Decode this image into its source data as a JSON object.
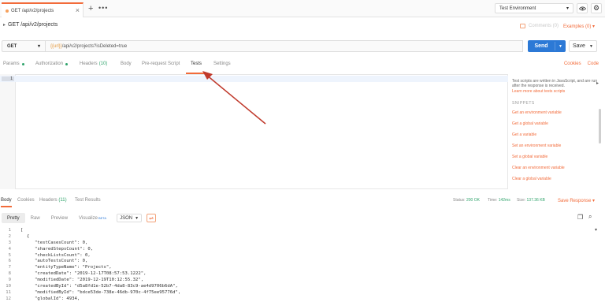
{
  "tabbar": {
    "tab_title": "GET /api/v2/projects",
    "close_glyph": "×",
    "plus_glyph": "+",
    "more_glyph": "•••",
    "environment": "Test Environment",
    "eye_icon": "eye-icon",
    "gear_icon": "gear-icon"
  },
  "header": {
    "title": "GET /api/v2/projects",
    "comments": "Comments (0)",
    "examples": "Examples (0) ▾"
  },
  "request": {
    "method": "GET",
    "url_var": "{{url}}",
    "url_rest": "/api/v2/projects?isDeleted=true",
    "send": "Send",
    "save": "Save"
  },
  "tabs": [
    {
      "label": "Params",
      "dot": true
    },
    {
      "label": "Authorization",
      "dot": true
    },
    {
      "label": "Headers",
      "count": "(10)"
    },
    {
      "label": "Body"
    },
    {
      "label": "Pre-request Script"
    },
    {
      "label": "Tests",
      "active": true
    },
    {
      "label": "Settings"
    }
  ],
  "right_links": {
    "cookies": "Cookies",
    "code": "Code"
  },
  "editor": {
    "line_number": "1"
  },
  "snippets": {
    "description": "Test scripts are written in JavaScript, and are run after the response is received.",
    "learn_more": "Learn more about tests scripts",
    "heading": "SNIPPETS",
    "items": [
      "Get an environment variable",
      "Get a global variable",
      "Get a variable",
      "Set an environment variable",
      "Set a global variable",
      "Clear an environment variable",
      "Clear a global variable"
    ]
  },
  "response_tabs": {
    "body": "Body",
    "cookies": "Cookies",
    "headers": "Headers",
    "headers_count": "(11)",
    "test_results": "Test Results"
  },
  "response_status": {
    "status_label": "Status:",
    "status": "200 OK",
    "time_label": "Time:",
    "time": "142ms",
    "size_label": "Size:",
    "size": "137.36 KB",
    "save_response": "Save Response ▾"
  },
  "format_toolbar": {
    "pretty": "Pretty",
    "raw": "Raw",
    "preview": "Preview",
    "visualize": "Visualize",
    "beta": "BETA",
    "format": "JSON",
    "wrap_icon": "wrap-lines-icon",
    "copy_icon": "copy-icon",
    "search_icon": "search-icon"
  },
  "response_body": [
    {
      "n": "1",
      "text": "[",
      "indent": 0
    },
    {
      "n": "2",
      "text": "{",
      "indent": 1
    },
    {
      "n": "3",
      "text": "\"testCasesCount\": 0,",
      "indent": 2
    },
    {
      "n": "4",
      "text": "\"sharedStepsCount\": 0,",
      "indent": 2
    },
    {
      "n": "5",
      "text": "\"checkListsCount\": 0,",
      "indent": 2
    },
    {
      "n": "6",
      "text": "\"autoTestsCount\": 0,",
      "indent": 2
    },
    {
      "n": "7",
      "text": "\"entityTypeName\": \"Projects\",",
      "indent": 2
    },
    {
      "n": "8",
      "text": "\"createdDate\": \"2019-12-17T08:57:53.1222\",",
      "indent": 2
    },
    {
      "n": "9",
      "text": "\"modifiedDate\": \"2019-12-19T10:12:55.32\",",
      "indent": 2
    },
    {
      "n": "10",
      "text": "\"createdById\": \"d5a8fd1e-52b7-4da8-83c9-ae4d9706b6dA\",",
      "indent": 2
    },
    {
      "n": "11",
      "text": "\"modifiedById\": \"bdce53de-738e-46db-970c-4f75ee95776d\",",
      "indent": 2
    },
    {
      "n": "12",
      "text": "\"globalId\": 4934,",
      "indent": 2
    }
  ]
}
